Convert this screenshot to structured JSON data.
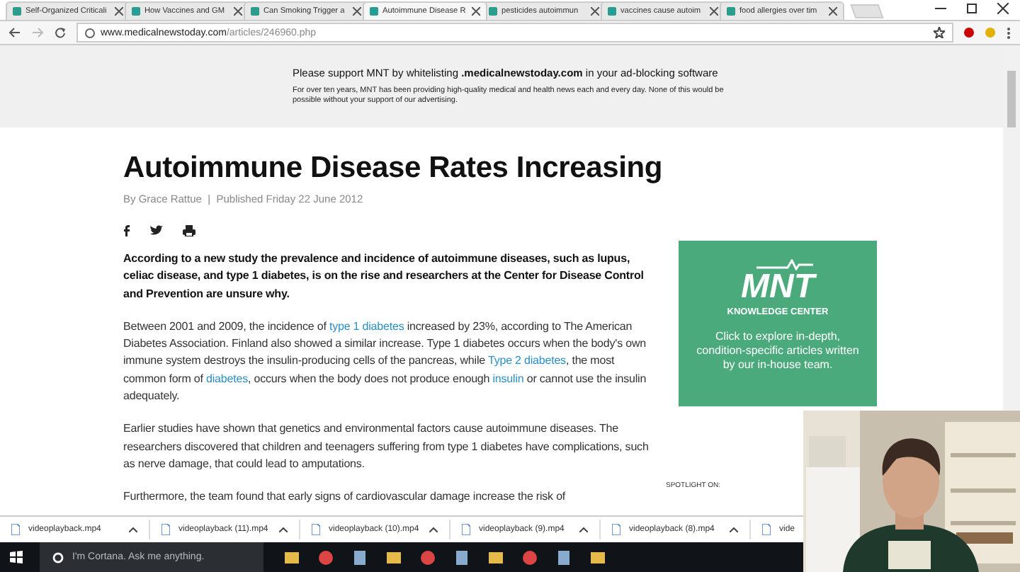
{
  "tabs": [
    {
      "label": "Self-Organized Criticali",
      "selected": false
    },
    {
      "label": "How Vaccines and GM",
      "selected": false
    },
    {
      "label": "Can Smoking Trigger a",
      "selected": false
    },
    {
      "label": "Autoimmune Disease R",
      "selected": true
    },
    {
      "label": "pesticides autoimmun",
      "selected": false
    },
    {
      "label": "vaccines cause autoim",
      "selected": false
    },
    {
      "label": "food allergies over tim",
      "selected": false
    }
  ],
  "address_bar": {
    "host": "www.medicalnewstoday.com",
    "path": "/articles/246960.php"
  },
  "banner": {
    "headline": "Please support MNT by whitelisting **.medicalnewstoday.com** in your ad-blocking software",
    "text": "For over ten years, MNT has been providing high-quality medical and health news each and every day. None of this would be possible without your support of our advertising."
  },
  "article": {
    "title": "Autoimmune Disease Rates Increasing",
    "byline": "By Grace Rattue  |  Published Friday 22 June 2012",
    "lead": "According to a new study the prevalence and incidence of autoimmune diseases, such as lupus, celiac disease, and type 1 diabetes, is on the rise and researchers at the Center for Disease Control and Prevention are unsure why.",
    "paragraphs": [
      [
        {
          "text": "Between 2001 and 2009, the incidence of ",
          "link": false
        },
        {
          "text": "type 1 diabetes",
          "link": true
        },
        {
          "text": " increased by 23%, according to The American Diabetes Association. Finland also showed a similar increase. Type 1 diabetes occurs when the body's own immune system destroys the insulin-producing cells of the pancreas, while ",
          "link": false
        },
        {
          "text": "Type 2 diabetes",
          "link": true
        },
        {
          "text": ", the most common form of ",
          "link": false
        },
        {
          "text": "diabetes",
          "link": true
        },
        {
          "text": ", occurs when the body does not produce enough ",
          "link": false
        },
        {
          "text": "insulin",
          "link": true
        },
        {
          "text": " or cannot use the insulin adequately.",
          "link": false
        }
      ],
      [
        {
          "text": "Earlier studies have shown that genetics and environmental factors cause autoimmune diseases. The researchers discovered that children and teenagers suffering from type 1 diabetes have complications, such as nerve damage, that could lead to amputations.",
          "link": false
        }
      ],
      [
        {
          "text": "Furthermore, the team found that early signs of cardiovascular damage increase the risk of",
          "link": false
        }
      ]
    ]
  },
  "promo": {
    "logo": "MNT",
    "subtitle": "KNOWLEDGE CENTER",
    "text": "Click to explore in-depth, condition-specific articles written by our in-house team."
  },
  "spotlight": "SPOTLIGHT ON:",
  "downloads": [
    "videoplayback.mp4",
    "videoplayback (11).mp4",
    "videoplayback (10).mp4",
    "videoplayback (9).mp4",
    "videoplayback (8).mp4",
    "vide"
  ],
  "taskbar": {
    "search_placeholder": "I'm Cortana. Ask me anything."
  }
}
